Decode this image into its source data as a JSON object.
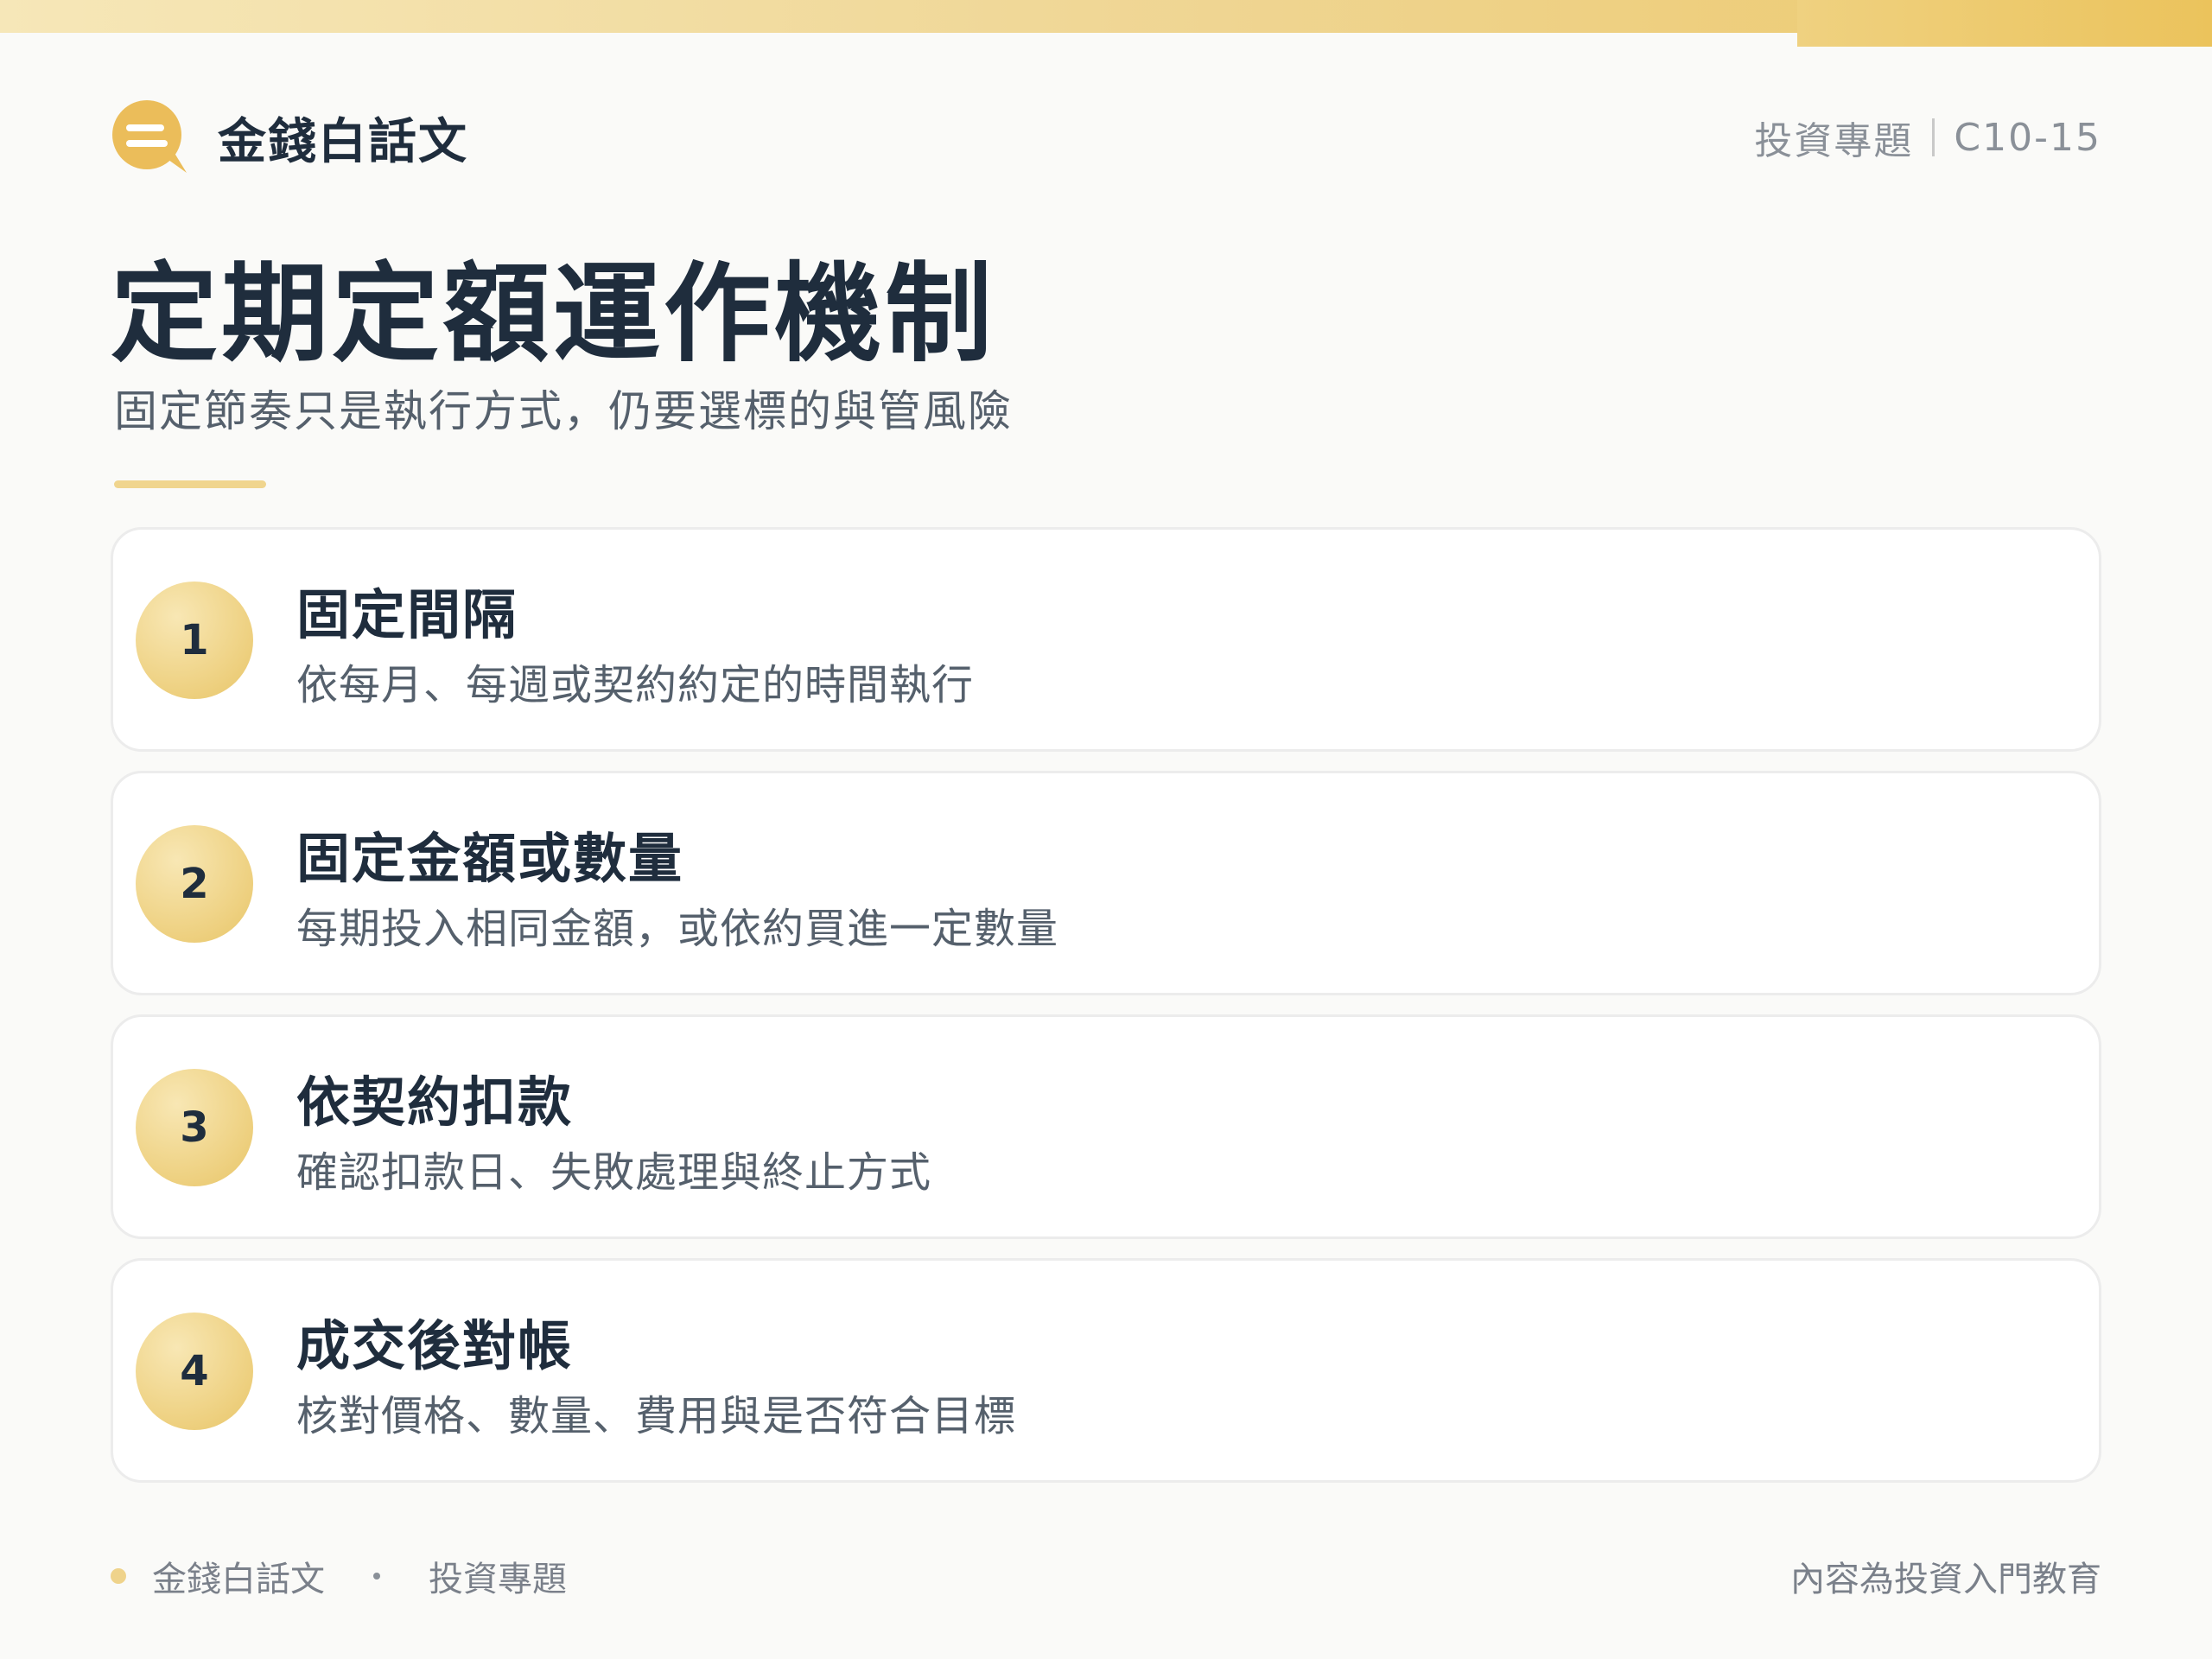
{
  "brand": {
    "name": "金錢白話文"
  },
  "meta": {
    "category": "投資專題",
    "code": "C10-15"
  },
  "title": "定期定額運作機制",
  "subtitle": "固定節奏只是執行方式，仍要選標的與管風險",
  "steps": [
    {
      "number": "1",
      "title": "固定間隔",
      "description": "依每月、每週或契約約定的時間執行"
    },
    {
      "number": "2",
      "title": "固定金額或數量",
      "description": "每期投入相同金額，或依約買進一定數量"
    },
    {
      "number": "3",
      "title": "依契約扣款",
      "description": "確認扣款日、失敗處理與終止方式"
    },
    {
      "number": "4",
      "title": "成交後對帳",
      "description": "核對價格、數量、費用與是否符合目標"
    }
  ],
  "footer": {
    "brand": "金錢白話文",
    "category": "投資專題",
    "note": "內容為投資入門教育"
  },
  "colors": {
    "accent_gold": "#efd38b",
    "text_dark": "#1f2d3d",
    "text_muted": "#55606c",
    "background": "#fafaf8"
  },
  "icons": {
    "brand_logo": "chat-bubble-icon"
  }
}
